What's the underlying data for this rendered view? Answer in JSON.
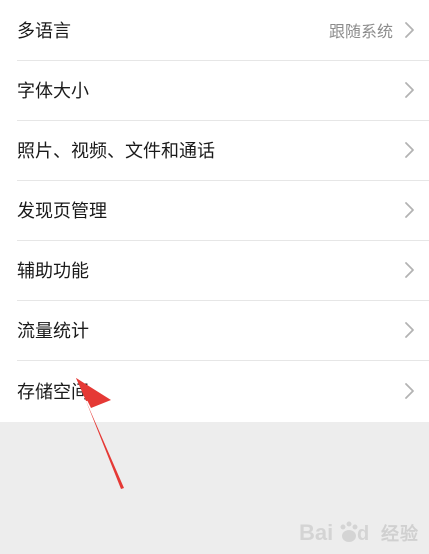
{
  "settings": {
    "items": [
      {
        "label": "多语言",
        "value": "跟随系统"
      },
      {
        "label": "字体大小",
        "value": ""
      },
      {
        "label": "照片、视频、文件和通话",
        "value": ""
      },
      {
        "label": "发现页管理",
        "value": ""
      },
      {
        "label": "辅助功能",
        "value": ""
      },
      {
        "label": "流量统计",
        "value": ""
      },
      {
        "label": "存储空间",
        "value": ""
      }
    ]
  },
  "icons": {
    "chevron": "chevron-right-icon",
    "annotation": "red-arrow-icon"
  },
  "colors": {
    "background": "#ededed",
    "list_bg": "#ffffff",
    "text": "#1a1a1a",
    "secondary_text": "#8c8c8c",
    "arrow": "#e53935"
  },
  "watermark": {
    "text": "经验"
  }
}
